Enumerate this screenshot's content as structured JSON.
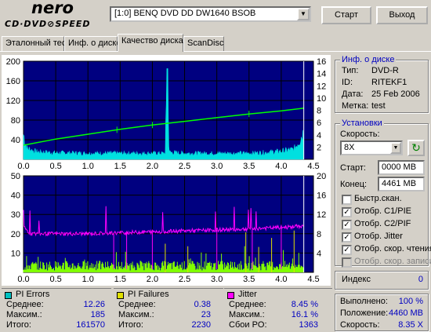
{
  "header": {
    "logo_top": "nero",
    "logo_bottom": "CD·DVD⊘SPEED",
    "drive": "[1:0]  BENQ DVD DD DW1640 BSOB",
    "start_label": "Старт",
    "exit_label": "Выход"
  },
  "tabs": [
    "Эталонный тест",
    "Инф. о диске",
    "Качество диска",
    "ScanDisc"
  ],
  "active_tab": "Качество диска",
  "disc_info": {
    "title": "Инф. о диске",
    "rows": [
      {
        "label": "Тип:",
        "value": "DVD-R"
      },
      {
        "label": "ID:",
        "value": "RITEKF1"
      },
      {
        "label": "Дата:",
        "value": "25 Feb 2006"
      },
      {
        "label": "Метка:",
        "value": "test"
      }
    ]
  },
  "settings": {
    "title": "Установки",
    "speed_label": "Скорость:",
    "speed_value": "8X",
    "start_label": "Старт:",
    "start_value": "0000 MB",
    "end_label": "Конец:",
    "end_value": "4461 MB",
    "checkboxes": [
      {
        "label": "Быстр.скан.",
        "checked": false,
        "enabled": true
      },
      {
        "label": "Отобр. C1/PIE",
        "checked": true,
        "enabled": true
      },
      {
        "label": "Отобр. C2/PIF",
        "checked": true,
        "enabled": true
      },
      {
        "label": "Отобр. Jitter",
        "checked": true,
        "enabled": true
      },
      {
        "label": "Отобр. скор. чтения",
        "checked": true,
        "enabled": true
      },
      {
        "label": "Отобр. скор. записи",
        "checked": false,
        "enabled": false
      }
    ]
  },
  "index": {
    "label": "Индекс",
    "value": "0"
  },
  "progress": {
    "rows": [
      {
        "label": "Выполнено:",
        "value": "100 %"
      },
      {
        "label": "Положение:",
        "value": "4460 MB"
      },
      {
        "label": "Скорость:",
        "value": "8.35 X"
      }
    ]
  },
  "stats": {
    "pi_errors": {
      "title": "PI Errors",
      "color": "#00c0c0",
      "rows": [
        {
          "label": "Среднее:",
          "value": "12.26"
        },
        {
          "label": "Максим.:",
          "value": "185"
        },
        {
          "label": "Итого:",
          "value": "161570"
        }
      ]
    },
    "pi_failures": {
      "title": "PI Failures",
      "color": "#e0e000",
      "rows": [
        {
          "label": "Среднее:",
          "value": "0.38"
        },
        {
          "label": "Максим.:",
          "value": "23"
        },
        {
          "label": "Итого:",
          "value": "2230"
        }
      ]
    },
    "jitter": {
      "title": "Jitter",
      "color": "#ff00ff",
      "rows": [
        {
          "label": "Среднее:",
          "value": "8.45 %"
        },
        {
          "label": "Максим.:",
          "value": "16.1 %"
        },
        {
          "label": "Сбои PO:",
          "value": "1363"
        }
      ]
    }
  },
  "colors": {
    "chart_bg": "#000080",
    "pie": "#00e0e0",
    "speed": "#00ff00",
    "pif": "#80ff00",
    "jitter": "#ff00ff",
    "grid": "#000000"
  },
  "chart_data": [
    {
      "type": "line",
      "title": "",
      "x_ticks": [
        "0.0",
        "0.5",
        "1.0",
        "1.5",
        "2.0",
        "2.5",
        "3.0",
        "3.5",
        "4.0",
        "4.5"
      ],
      "xlim": [
        0,
        4.5
      ],
      "y_left_ticks": [
        "200",
        "160",
        "120",
        "80",
        "40"
      ],
      "ylim_left": [
        0,
        200
      ],
      "y_right_ticks": [
        "16",
        "14",
        "12",
        "10",
        "8",
        "6",
        "4",
        "2"
      ],
      "ylim_right": [
        0,
        16
      ],
      "series": [
        {
          "name": "PI Errors",
          "axis": "left",
          "x": [
            0.0,
            0.05,
            0.2,
            0.5,
            1.0,
            1.5,
            2.0,
            2.2,
            2.23,
            2.26,
            2.5,
            3.0,
            3.5,
            3.8,
            4.0,
            4.2,
            4.35
          ],
          "y": [
            50,
            22,
            15,
            13,
            12,
            12,
            12,
            12,
            185,
            14,
            12,
            12,
            12,
            14,
            16,
            20,
            55
          ]
        },
        {
          "name": "Скорость",
          "axis": "right",
          "x": [
            0.0,
            0.5,
            1.0,
            1.5,
            2.0,
            2.5,
            3.0,
            3.5,
            4.0,
            4.35
          ],
          "y": [
            2.3,
            3.3,
            4.1,
            4.9,
            5.6,
            6.2,
            6.8,
            7.4,
            7.9,
            8.35
          ]
        }
      ]
    },
    {
      "type": "line",
      "title": "",
      "x_ticks": [
        "0.0",
        "0.5",
        "1.0",
        "1.5",
        "2.0",
        "2.5",
        "3.0",
        "3.5",
        "4.0",
        "4.5"
      ],
      "xlim": [
        0,
        4.5
      ],
      "y_left_ticks": [
        "50",
        "40",
        "30",
        "20",
        "10"
      ],
      "ylim_left": [
        0,
        50
      ],
      "y_right_ticks": [
        "20",
        "16",
        "12",
        "8",
        "4"
      ],
      "ylim_right": [
        0,
        20
      ],
      "series": [
        {
          "name": "PI Failures",
          "axis": "left",
          "x": [
            0.0,
            0.5,
            1.0,
            1.5,
            2.0,
            2.2,
            2.5,
            3.0,
            3.5,
            3.8,
            4.0,
            4.35
          ],
          "y": [
            2,
            1,
            1,
            1,
            1,
            1,
            1,
            1,
            1,
            2,
            2,
            3
          ]
        },
        {
          "name": "Jitter",
          "axis": "right",
          "x": [
            0.0,
            0.1,
            0.5,
            1.0,
            1.5,
            2.0,
            2.5,
            3.0,
            3.5,
            4.0,
            4.35
          ],
          "y": [
            9.5,
            8.0,
            8.0,
            8.0,
            8.2,
            8.4,
            8.6,
            8.8,
            9.0,
            9.3,
            9.6
          ]
        }
      ]
    }
  ]
}
